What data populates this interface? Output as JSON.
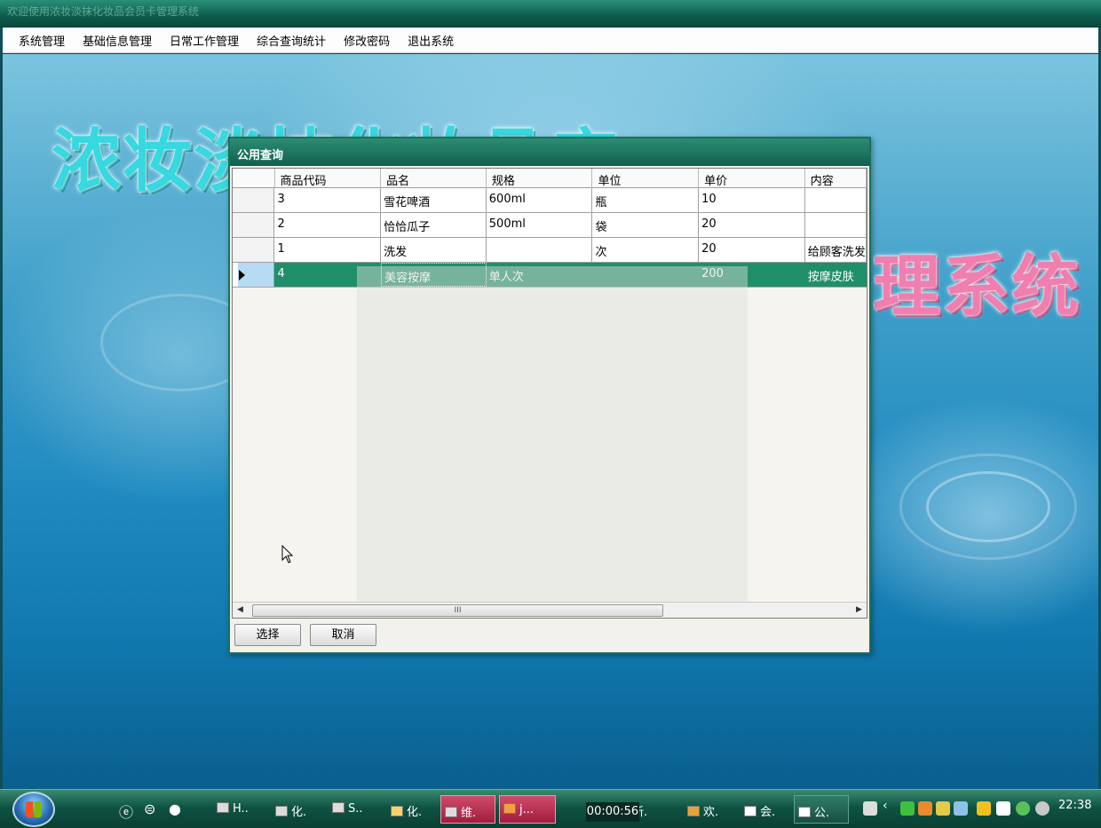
{
  "window": {
    "title": "欢迎使用浓妆淡抹化妆品会员卡管理系统"
  },
  "menu": {
    "items": [
      "系统管理",
      "基础信息管理",
      "日常工作管理",
      "综合查询统计",
      "修改密码",
      "退出系统"
    ]
  },
  "banner": {
    "left_text": "浓妆淡抹化妆品店",
    "right_text": "理系统"
  },
  "dialog": {
    "title": "公用查询",
    "columns": [
      "商品代码",
      "品名",
      "规格",
      "单位",
      "单价",
      "内容"
    ],
    "rows": [
      {
        "code": "3",
        "name": "雪花啤酒",
        "spec": "600ml",
        "unit": "瓶",
        "price": "10",
        "content": ""
      },
      {
        "code": "2",
        "name": "恰恰瓜子",
        "spec": "500ml",
        "unit": "袋",
        "price": "20",
        "content": ""
      },
      {
        "code": "1",
        "name": "洗发",
        "spec": "",
        "unit": "次",
        "price": "20",
        "content": "给顾客洗发"
      },
      {
        "code": "4",
        "name": "美容按摩",
        "spec": "单人次",
        "unit": "",
        "price": "200",
        "content": "按摩皮肤"
      }
    ],
    "selected_row_index": 3,
    "scrollbar_thumb_label": "III",
    "select_button": "选择",
    "cancel_button": "取消"
  },
  "taskbar": {
    "quick_launch": [
      "ie-icon",
      "refresh-icon",
      "media-icon"
    ],
    "buttons": [
      {
        "label": "H..",
        "icon": "doc-icon"
      },
      {
        "label": "化.",
        "icon": "word-icon"
      },
      {
        "label": "S..",
        "icon": "app-icon"
      },
      {
        "label": "化.",
        "icon": "folder-icon"
      },
      {
        "label": "维.",
        "icon": "app-icon"
      },
      {
        "label": "j...",
        "icon": "app-icon"
      },
      {
        "label": "新.",
        "icon": "app-icon"
      },
      {
        "label": "欢.",
        "icon": "window-icon"
      },
      {
        "label": "会.",
        "icon": "window-icon"
      },
      {
        "label": "公.",
        "icon": "window-icon"
      }
    ],
    "timer": "00:00:56",
    "clock": "22:38"
  },
  "colors": {
    "titlebar": "#11604d",
    "selection": "#1f8f6a",
    "banner_cyan": "#37d8e0",
    "banner_pink": "#f07fb0"
  }
}
